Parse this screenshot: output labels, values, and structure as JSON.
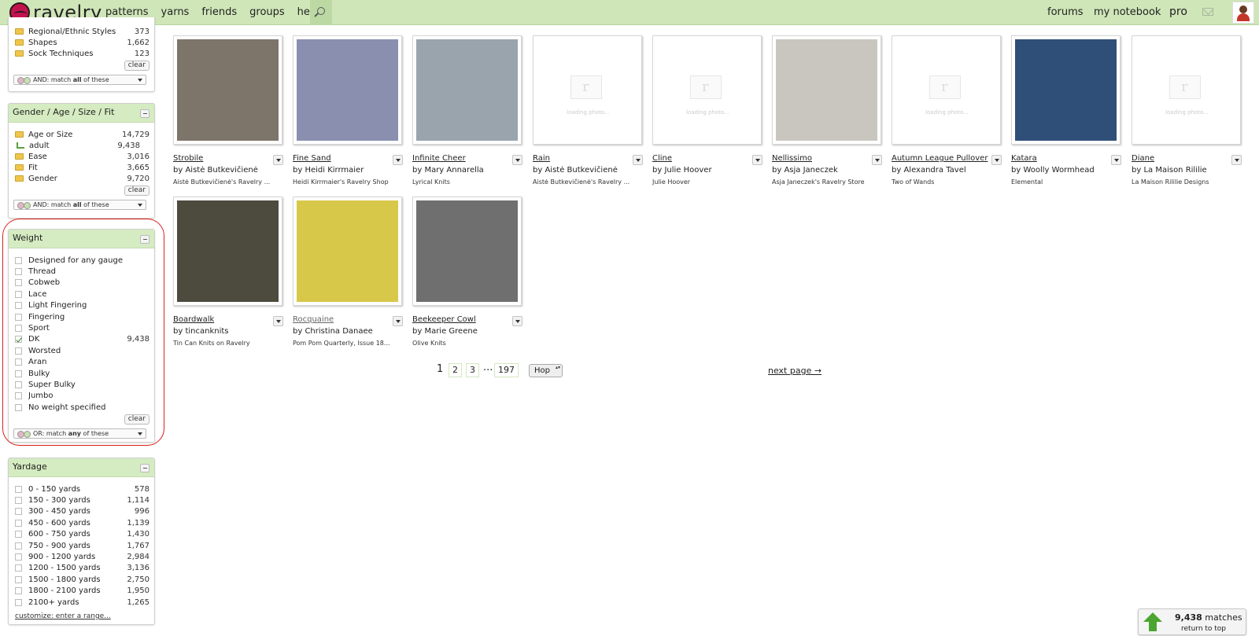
{
  "nav": {
    "brand": "ravelry",
    "left_items": [
      "patterns",
      "yarns",
      "friends",
      "groups",
      "help"
    ],
    "forums": "forums",
    "notebook": "my notebook",
    "pro": "pro"
  },
  "sidebar": {
    "category_panel": {
      "items": [
        {
          "label": "Regional/Ethnic Styles",
          "count": "373"
        },
        {
          "label": "Shapes",
          "count": "1,662"
        },
        {
          "label": "Sock Techniques",
          "count": "123"
        }
      ],
      "clear": "clear",
      "match_pre": "AND: match ",
      "match_bold": "all",
      "match_post": " of these"
    },
    "gender_panel": {
      "title": "Gender / Age / Size / Fit",
      "items": [
        {
          "label": "Age or Size",
          "count": "14,729"
        },
        {
          "label": "adult",
          "count": "9,438"
        },
        {
          "label": "Ease",
          "count": "3,016"
        },
        {
          "label": "Fit",
          "count": "3,665"
        },
        {
          "label": "Gender",
          "count": "9,720"
        }
      ],
      "clear": "clear",
      "match_pre": "AND: match ",
      "match_bold": "all",
      "match_post": " of these"
    },
    "weight_panel": {
      "title": "Weight",
      "items": [
        {
          "label": "Designed for any gauge",
          "count": "",
          "checked": false
        },
        {
          "label": "Thread",
          "count": "",
          "checked": false
        },
        {
          "label": "Cobweb",
          "count": "",
          "checked": false
        },
        {
          "label": "Lace",
          "count": "",
          "checked": false
        },
        {
          "label": "Light Fingering",
          "count": "",
          "checked": false
        },
        {
          "label": "Fingering",
          "count": "",
          "checked": false
        },
        {
          "label": "Sport",
          "count": "",
          "checked": false
        },
        {
          "label": "DK",
          "count": "9,438",
          "checked": true
        },
        {
          "label": "Worsted",
          "count": "",
          "checked": false
        },
        {
          "label": "Aran",
          "count": "",
          "checked": false
        },
        {
          "label": "Bulky",
          "count": "",
          "checked": false
        },
        {
          "label": "Super Bulky",
          "count": "",
          "checked": false
        },
        {
          "label": "Jumbo",
          "count": "",
          "checked": false
        },
        {
          "label": "No weight specified",
          "count": "",
          "checked": false
        }
      ],
      "clear": "clear",
      "match_pre": "OR: match ",
      "match_bold": "any",
      "match_post": " of these"
    },
    "yardage_panel": {
      "title": "Yardage",
      "items": [
        {
          "label": "0 - 150 yards",
          "count": "578"
        },
        {
          "label": "150 - 300 yards",
          "count": "1,114"
        },
        {
          "label": "300 - 450 yards",
          "count": "996"
        },
        {
          "label": "450 - 600 yards",
          "count": "1,139"
        },
        {
          "label": "600 - 750 yards",
          "count": "1,430"
        },
        {
          "label": "750 - 900 yards",
          "count": "1,767"
        },
        {
          "label": "900 - 1200 yards",
          "count": "2,984"
        },
        {
          "label": "1200 - 1500 yards",
          "count": "3,136"
        },
        {
          "label": "1500 - 1800 yards",
          "count": "2,750"
        },
        {
          "label": "1800 - 2100 yards",
          "count": "1,950"
        },
        {
          "label": "2100+ yards",
          "count": "1,265"
        }
      ],
      "customize": "customize: enter a range..."
    }
  },
  "patterns": [
    {
      "name": "Strobile",
      "by": "by Aistė Butkevičienė",
      "source": "Aistė Butkevičienė's Ravelry ...",
      "photo": "#7d746a",
      "loading": false
    },
    {
      "name": "Fine Sand",
      "by": "by Heidi Kirrmaier",
      "source": "Heidi Kirrmaier's Ravelry Shop",
      "photo": "#8a8fb0",
      "loading": false
    },
    {
      "name": "Infinite Cheer",
      "by": "by Mary Annarella",
      "source": "Lyrical Knits",
      "photo": "#9aa4ad",
      "loading": false
    },
    {
      "name": "Rain",
      "by": "by Aistė Butkevičienė",
      "source": "Aistė Butkevičienė's Ravelry ...",
      "photo": "",
      "loading": true
    },
    {
      "name": "Cline",
      "by": "by Julie Hoover",
      "source": "Julie Hoover",
      "photo": "",
      "loading": true
    },
    {
      "name": "Nellissimo",
      "by": "by Asja Janeczek",
      "source": "Asja Janeczek's Ravelry Store",
      "photo": "#c9c6bf",
      "loading": false
    },
    {
      "name": "Autumn League Pullover",
      "by": "by Alexandra Tavel",
      "source": "Two of Wands",
      "photo": "",
      "loading": true
    },
    {
      "name": "Katara",
      "by": "by Woolly Wormhead",
      "source": "Elemental",
      "photo": "#2f4f78",
      "loading": false
    },
    {
      "name": "Diane",
      "by": "by La Maison Rililie",
      "source": "La Maison Rililie Designs",
      "photo": "",
      "loading": true
    },
    {
      "name": "Boardwalk",
      "by": "by tincanknits",
      "source": "Tin Can Knits on Ravelry",
      "photo": "#4d4a3e",
      "loading": false
    },
    {
      "name": "Rocquaine",
      "by": "by Christina Danaee",
      "source": "Pom Pom Quarterly, Issue 18...",
      "photo": "#d8c84a",
      "loading": false
    },
    {
      "name": "Beekeeper Cowl",
      "by": "by Marie Greene",
      "source": "Olive Knits",
      "photo": "#6f6f6f",
      "loading": false
    }
  ],
  "loading_text": "loading photo...",
  "pagination": {
    "current": "1",
    "pages": [
      "2",
      "3"
    ],
    "ellipsis": "...",
    "last": "197",
    "hop": "Hop",
    "next": "next page →"
  },
  "matches": {
    "count": "9,438",
    "label": "matches",
    "return": "return to top"
  },
  "colors": {
    "nav_bg": "#cfe6b8",
    "panel_header": "#d5ebc1",
    "accent_green": "#4ba531",
    "highlight_red": "#d9201c"
  }
}
